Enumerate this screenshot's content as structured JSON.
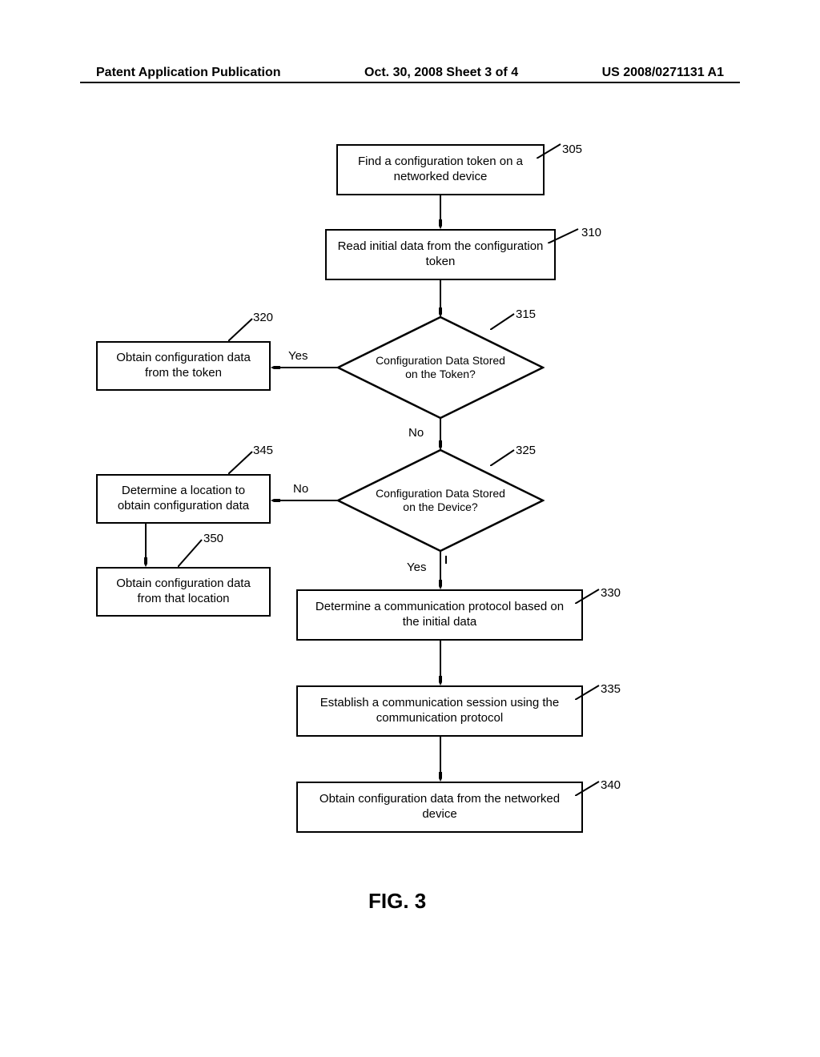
{
  "header": {
    "left": "Patent Application Publication",
    "center": "Oct. 30, 2008  Sheet 3 of 4",
    "right": "US 2008/0271131 A1"
  },
  "nodes": {
    "n305": {
      "text": "Find a configuration token on a networked device",
      "ref": "305"
    },
    "n310": {
      "text": "Read initial data from the configuration token",
      "ref": "310"
    },
    "n315": {
      "text": "Configuration Data Stored on the Token?",
      "ref": "315"
    },
    "n320": {
      "text": "Obtain configuration data from the token",
      "ref": "320"
    },
    "n325": {
      "text": "Configuration Data Stored on the Device?",
      "ref": "325"
    },
    "n330": {
      "text": "Determine a communication protocol based on the initial data",
      "ref": "330"
    },
    "n335": {
      "text": "Establish a communication session using the communication protocol",
      "ref": "335"
    },
    "n340": {
      "text": "Obtain configuration data from the networked device",
      "ref": "340"
    },
    "n345": {
      "text": "Determine a location to obtain configuration data",
      "ref": "345"
    },
    "n350": {
      "text": "Obtain configuration data from that location",
      "ref": "350"
    }
  },
  "edges": {
    "yes315": "Yes",
    "no315": "No",
    "yes325": "Yes",
    "no325": "No"
  },
  "figure": "FIG. 3"
}
